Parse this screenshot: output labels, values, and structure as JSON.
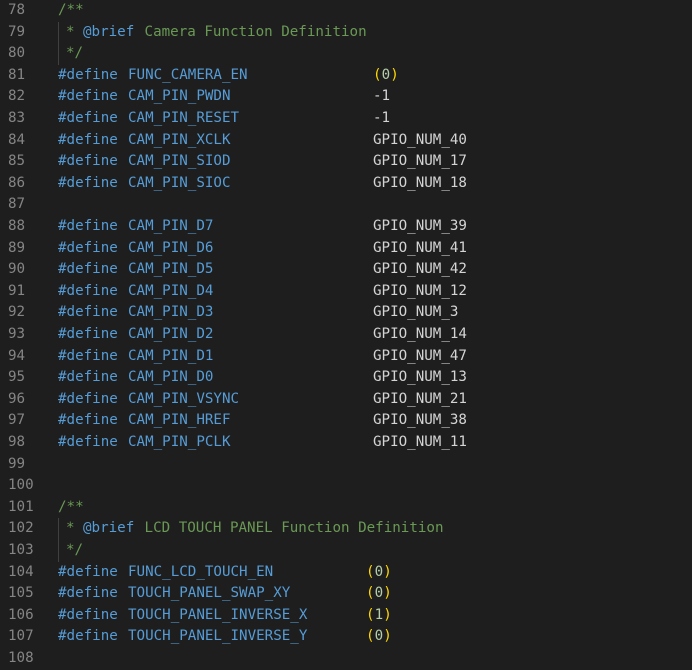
{
  "lines": [
    {
      "n": "78",
      "comment": "/**"
    },
    {
      "n": "79",
      "comment_prefix": "* ",
      "doctag": "@brief",
      "comment_text": " Camera Function Definition"
    },
    {
      "n": "80",
      "comment": "*/"
    },
    {
      "n": "81",
      "kw": "#define",
      "macro": "FUNC_CAMERA_EN",
      "paren_open": "(",
      "num": "0",
      "paren_close": ")"
    },
    {
      "n": "82",
      "kw": "#define",
      "macro": "CAM_PIN_PWDN",
      "val": "-1"
    },
    {
      "n": "83",
      "kw": "#define",
      "macro": "CAM_PIN_RESET",
      "val": "-1"
    },
    {
      "n": "84",
      "kw": "#define",
      "macro": "CAM_PIN_XCLK",
      "val": "GPIO_NUM_40"
    },
    {
      "n": "85",
      "kw": "#define",
      "macro": "CAM_PIN_SIOD",
      "val": "GPIO_NUM_17"
    },
    {
      "n": "86",
      "kw": "#define",
      "macro": "CAM_PIN_SIOC",
      "val": "GPIO_NUM_18"
    },
    {
      "n": "87"
    },
    {
      "n": "88",
      "kw": "#define",
      "macro": "CAM_PIN_D7",
      "val": "GPIO_NUM_39"
    },
    {
      "n": "89",
      "kw": "#define",
      "macro": "CAM_PIN_D6",
      "val": "GPIO_NUM_41"
    },
    {
      "n": "90",
      "kw": "#define",
      "macro": "CAM_PIN_D5",
      "val": "GPIO_NUM_42"
    },
    {
      "n": "91",
      "kw": "#define",
      "macro": "CAM_PIN_D4",
      "val": "GPIO_NUM_12"
    },
    {
      "n": "92",
      "kw": "#define",
      "macro": "CAM_PIN_D3",
      "val": "GPIO_NUM_3"
    },
    {
      "n": "93",
      "kw": "#define",
      "macro": "CAM_PIN_D2",
      "val": "GPIO_NUM_14"
    },
    {
      "n": "94",
      "kw": "#define",
      "macro": "CAM_PIN_D1",
      "val": "GPIO_NUM_47"
    },
    {
      "n": "95",
      "kw": "#define",
      "macro": "CAM_PIN_D0",
      "val": "GPIO_NUM_13"
    },
    {
      "n": "96",
      "kw": "#define",
      "macro": "CAM_PIN_VSYNC",
      "val": "GPIO_NUM_21"
    },
    {
      "n": "97",
      "kw": "#define",
      "macro": "CAM_PIN_HREF",
      "val": "GPIO_NUM_38"
    },
    {
      "n": "98",
      "kw": "#define",
      "macro": "CAM_PIN_PCLK",
      "val": "GPIO_NUM_11"
    },
    {
      "n": "99"
    },
    {
      "n": "100"
    },
    {
      "n": "101",
      "comment": "/**"
    },
    {
      "n": "102",
      "comment_prefix": "* ",
      "doctag": "@brief",
      "comment_text": " LCD TOUCH PANEL Function Definition"
    },
    {
      "n": "103",
      "comment": "*/"
    },
    {
      "n": "104",
      "kw": "#define",
      "macro": "FUNC_LCD_TOUCH_EN",
      "paren_open": "(",
      "num": "0",
      "paren_close": ")"
    },
    {
      "n": "105",
      "kw": "#define",
      "macro": "TOUCH_PANEL_SWAP_XY",
      "paren_open": "(",
      "num": "0",
      "paren_close": ")"
    },
    {
      "n": "106",
      "kw": "#define",
      "macro": "TOUCH_PANEL_INVERSE_X",
      "paren_open": "(",
      "num": "1",
      "paren_close": ")"
    },
    {
      "n": "107",
      "kw": "#define",
      "macro": "TOUCH_PANEL_INVERSE_Y",
      "paren_open": "(",
      "num": "0",
      "paren_close": ")"
    },
    {
      "n": "108"
    }
  ],
  "colors": {
    "background": "#1e1e1e",
    "line_number": "#858585",
    "comment": "#6a9955",
    "keyword": "#569cd6",
    "value": "#d4d4d4",
    "bracket": "#ffd700",
    "number": "#b5cea8"
  }
}
